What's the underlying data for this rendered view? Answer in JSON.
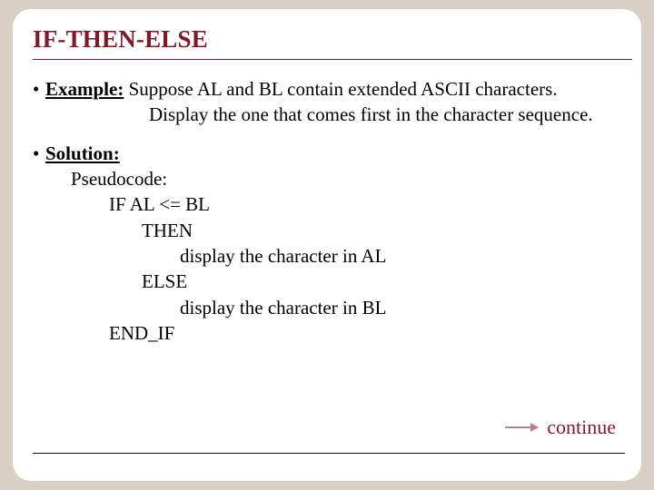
{
  "title": "IF-THEN-ELSE",
  "example": {
    "label": "Example:",
    "line1": " Suppose AL and BL contain extended ASCII characters.",
    "line2": "Display the one that comes first in the character sequence."
  },
  "solution": {
    "label": "Solution:",
    "pseudo_label": "Pseudocode:",
    "lines": {
      "if": "IF AL <= BL",
      "then": "THEN",
      "then_body": "display the character in AL",
      "else": "ELSE",
      "else_body": "display the character in BL",
      "endif": "END_IF"
    }
  },
  "continue": "continue",
  "bullet": "•"
}
